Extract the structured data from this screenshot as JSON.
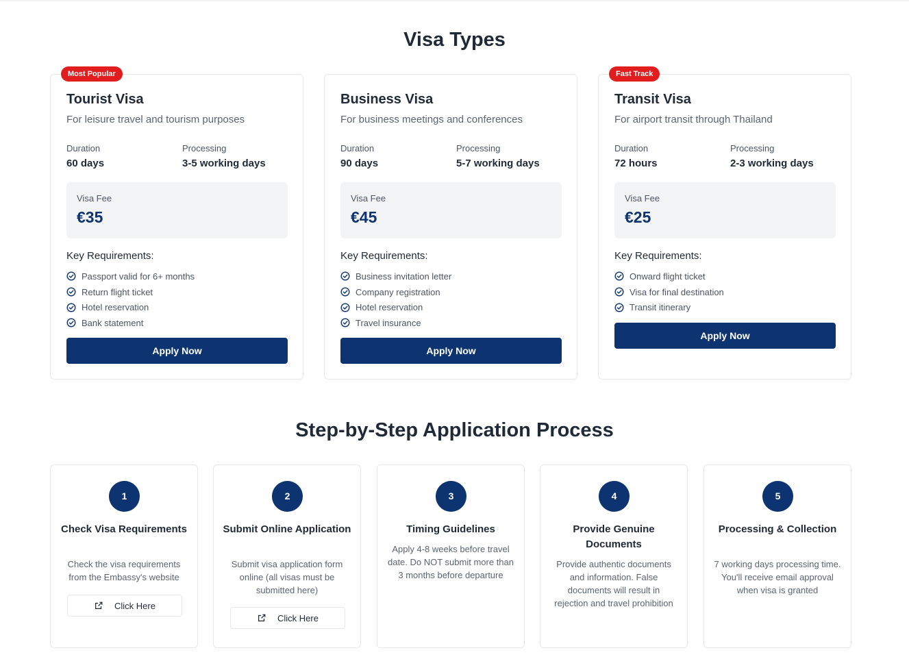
{
  "visa_section": {
    "title": "Visa Types",
    "duration_label": "Duration",
    "processing_label": "Processing",
    "fee_label": "Visa Fee",
    "requirements_label": "Key Requirements:",
    "apply_label": "Apply Now",
    "cards": [
      {
        "badge": "Most Popular",
        "name": "Tourist Visa",
        "description": "For leisure travel and tourism purposes",
        "duration": "60 days",
        "processing": "3-5 working days",
        "fee": "€35",
        "requirements": [
          "Passport valid for 6+ months",
          "Return flight ticket",
          "Hotel reservation",
          "Bank statement"
        ]
      },
      {
        "badge": "",
        "name": "Business Visa",
        "description": "For business meetings and conferences",
        "duration": "90 days",
        "processing": "5-7 working days",
        "fee": "€45",
        "requirements": [
          "Business invitation letter",
          "Company registration",
          "Hotel reservation",
          "Travel insurance"
        ]
      },
      {
        "badge": "Fast Track",
        "name": "Transit Visa",
        "description": "For airport transit through Thailand",
        "duration": "72 hours",
        "processing": "2-3 working days",
        "fee": "€25",
        "requirements": [
          "Onward flight ticket",
          "Visa for final destination",
          "Transit itinerary"
        ]
      }
    ]
  },
  "process_section": {
    "title": "Step-by-Step Application Process",
    "click_label": "Click Here",
    "steps": [
      {
        "number": "1",
        "title": "Check Visa Requirements",
        "description": "Check the visa requirements from the Embassy's website"
      },
      {
        "number": "2",
        "title": "Submit Online Application",
        "description": "Submit visa application form online (all visas must be submitted here)"
      },
      {
        "number": "3",
        "title": "Timing Guidelines",
        "description": "Apply 4-8 weeks before travel date. Do NOT submit more than 3 months before departure"
      },
      {
        "number": "4",
        "title": "Provide Genuine Documents",
        "description": "Provide authentic documents and information. False documents will result in rejection and travel prohibition"
      },
      {
        "number": "5",
        "title": "Processing & Collection",
        "description": "7 working days processing time. You'll receive email approval when visa is granted"
      }
    ]
  },
  "icons": {
    "check": "check-circle-icon",
    "external": "external-link-icon"
  },
  "colors": {
    "primary": "#0d3470",
    "badge": "#e11d1d",
    "fee_bg": "#f3f4f6"
  }
}
